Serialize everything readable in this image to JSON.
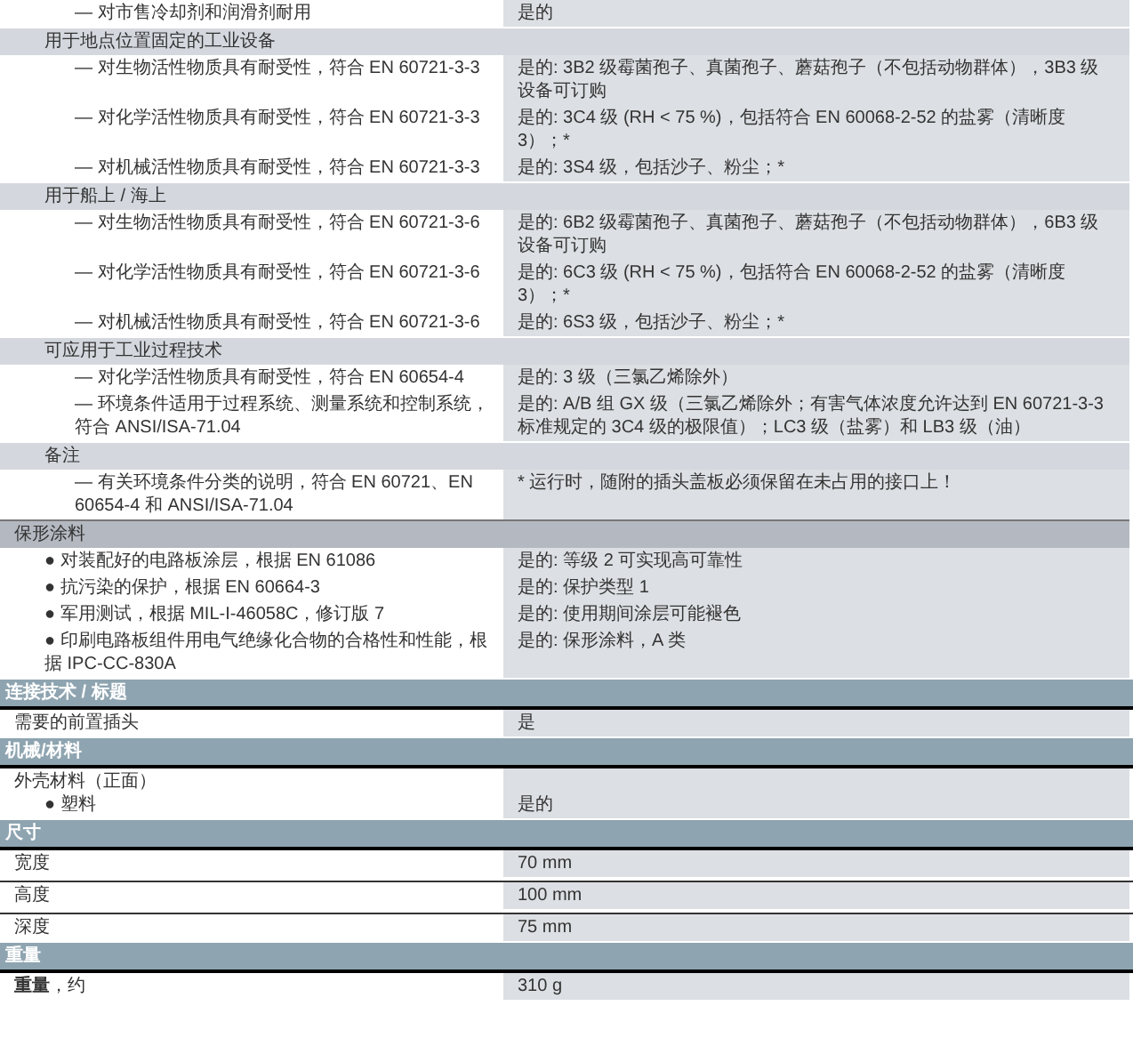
{
  "environment": {
    "rows": [
      {
        "label": "— 对市售冷却剂和润滑剂耐用",
        "value": "是的"
      }
    ],
    "groups": [
      {
        "title": "用于地点位置固定的工业设备",
        "rows": [
          {
            "label": "— 对生物活性物质具有耐受性，符合 EN 60721-3-3",
            "value": "是的: 3B2 级霉菌孢子、真菌孢子、蘑菇孢子（不包括动物群体），3B3 级设备可订购"
          },
          {
            "label": "— 对化学活性物质具有耐受性，符合 EN 60721-3-3",
            "value": "是的: 3C4 级 (RH < 75 %)，包括符合 EN 60068-2-52 的盐雾（清晰度 3）；*"
          },
          {
            "label": "— 对机械活性物质具有耐受性，符合 EN 60721-3-3",
            "value": "是的: 3S4 级，包括沙子、粉尘；*"
          }
        ]
      },
      {
        "title": "用于船上 / 海上",
        "rows": [
          {
            "label": "— 对生物活性物质具有耐受性，符合 EN 60721-3-6",
            "value": "是的: 6B2 级霉菌孢子、真菌孢子、蘑菇孢子（不包括动物群体），6B3 级设备可订购"
          },
          {
            "label": "— 对化学活性物质具有耐受性，符合 EN 60721-3-6",
            "value": "是的: 6C3 级 (RH < 75 %)，包括符合 EN 60068-2-52 的盐雾（清晰度 3）；*"
          },
          {
            "label": "— 对机械活性物质具有耐受性，符合 EN 60721-3-6",
            "value": "是的: 6S3 级，包括沙子、粉尘；*"
          }
        ]
      },
      {
        "title": "可应用于工业过程技术",
        "rows": [
          {
            "label": "— 对化学活性物质具有耐受性，符合 EN 60654-4",
            "value": "是的: 3 级（三氯乙烯除外）"
          },
          {
            "label": "— 环境条件适用于过程系统、测量系统和控制系统，符合 ANSI/ISA-71.04",
            "value": "是的: A/B 组 GX 级（三氯乙烯除外；有害气体浓度允许达到 EN 60721-3-3 标准规定的 3C4 级的极限值）；LC3 级（盐雾）和 LB3 级（油）"
          }
        ]
      },
      {
        "title": "备注",
        "rows": [
          {
            "label": "— 有关环境条件分类的说明，符合 EN 60721、EN 60654-4 和 ANSI/ISA-71.04",
            "value": "* 运行时，随附的插头盖板必须保留在未占用的接口上！"
          }
        ]
      }
    ]
  },
  "conformal_coating": {
    "title": "保形涂料",
    "rows": [
      {
        "label": "● 对装配好的电路板涂层，根据 EN 61086",
        "value": "是的: 等级 2 可实现高可靠性"
      },
      {
        "label": "● 抗污染的保护，根据 EN 60664-3",
        "value": "是的: 保护类型 1"
      },
      {
        "label": "● 军用测试，根据 MIL-I-46058C，修订版 7",
        "value": "是的: 使用期间涂层可能褪色"
      },
      {
        "label": "● 印刷电路板组件用电气绝缘化合物的合格性和性能，根据 IPC-CC-830A",
        "value": "是的: 保形涂料，A 类"
      }
    ]
  },
  "sections": [
    {
      "title": "连接技术 / 标题",
      "rows": [
        {
          "label": "需要的前置插头",
          "value": "是"
        }
      ]
    },
    {
      "title": "机械/材料",
      "rows": [
        {
          "label": "外壳材料（正面）",
          "children": [
            {
              "label": "● 塑料",
              "value": "是的"
            }
          ]
        }
      ]
    },
    {
      "title": "尺寸",
      "ruled": true,
      "rows": [
        {
          "label": "宽度",
          "value": "70 mm"
        },
        {
          "label": "高度",
          "value": "100 mm"
        },
        {
          "label": "深度",
          "value": "75 mm"
        }
      ]
    },
    {
      "title": "重量",
      "rows": [
        {
          "label": "**重量**，约",
          "value": "310 g"
        }
      ]
    }
  ]
}
